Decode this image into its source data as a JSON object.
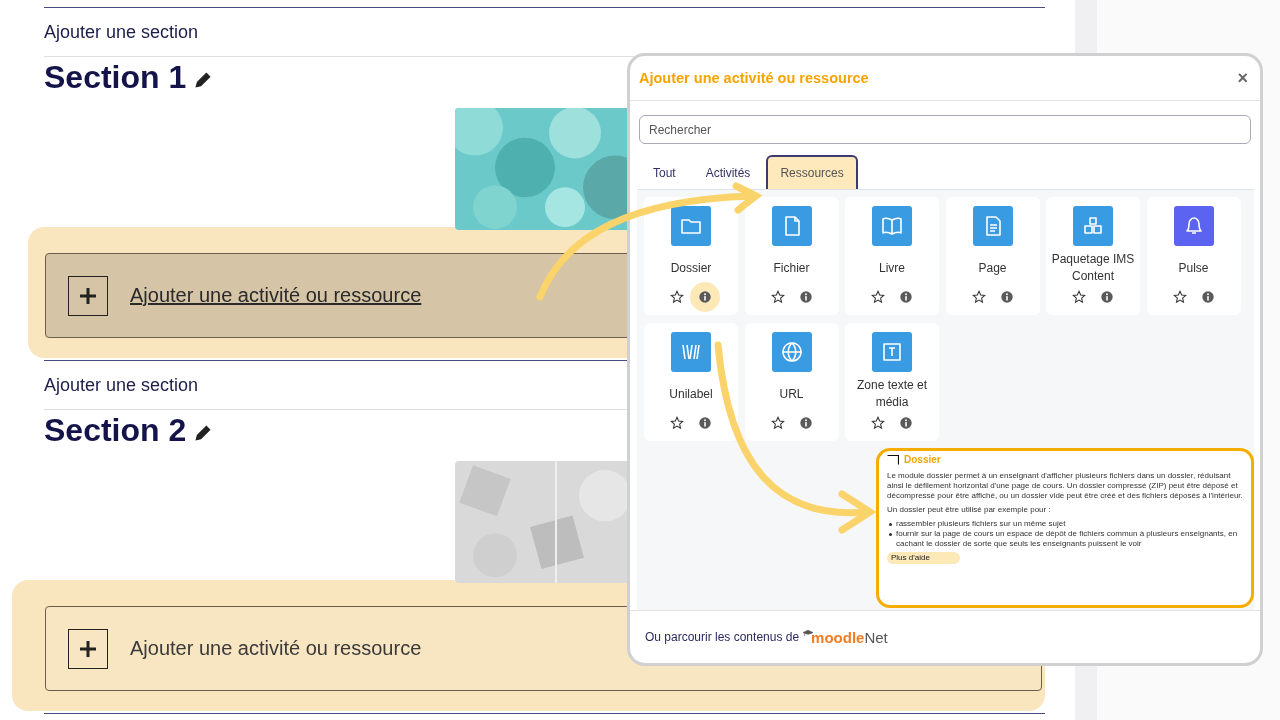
{
  "sections": [
    {
      "add_section": "Ajouter une section",
      "title": "Section 1",
      "add_activity": {
        "label": "Ajouter une activité ou ressource",
        "hovered": true
      }
    },
    {
      "add_section": "Ajouter une section",
      "title": "Section 2",
      "add_activity": {
        "label": "Ajouter une activité ou ressource",
        "hovered": false
      }
    }
  ],
  "modal": {
    "title": "Ajouter une activité ou ressource",
    "close": "×",
    "search": {
      "placeholder": "Rechercher"
    },
    "tabs": [
      {
        "label": "Tout",
        "selected": false
      },
      {
        "label": "Activités",
        "selected": false
      },
      {
        "label": "Ressources",
        "selected": true
      }
    ],
    "items": [
      {
        "label": "Dossier",
        "color": "#399be2",
        "info_highlighted": true
      },
      {
        "label": "Fichier",
        "color": "#399be2",
        "info_highlighted": false
      },
      {
        "label": "Livre",
        "color": "#399be2",
        "info_highlighted": false
      },
      {
        "label": "Page",
        "color": "#399be2",
        "info_highlighted": false
      },
      {
        "label": "Paquetage IMS Content",
        "color": "#399be2",
        "info_highlighted": false
      },
      {
        "label": "Pulse",
        "color": "#5b63f0",
        "info_highlighted": false
      },
      {
        "label": "Unilabel",
        "color": "#399be2",
        "info_highlighted": false
      },
      {
        "label": "URL",
        "color": "#399be2",
        "info_highlighted": false
      },
      {
        "label": "Zone texte et média",
        "color": "#399be2",
        "info_highlighted": false
      }
    ],
    "help": {
      "title": "Dossier",
      "paragraph": "Le module dossier permet à un enseignant d'afficher plusieurs fichiers dans un dossier, réduisant ainsi le défilement horizontal d'une page de cours. Un dossier compressé (ZIP) peut être déposé et décompressé pour être affiché, ou un dossier vide peut être créé et des fichiers déposés à l'intérieur.",
      "intro": "Un dossier peut être utilisé par exemple pour :",
      "bullets": [
        "rassembler plusieurs fichiers sur un même sujet",
        "fournir sur la page de cours un espace de dépôt de fichiers commun à plusieurs enseignants, en cachant le dossier de sorte que seuls les enseignants puissent le voir"
      ],
      "more": {
        "label": "Plus d'aide",
        "highlighted": true
      }
    },
    "footer": {
      "text": "Ou parcourir les contenus de",
      "logo_a": "moodle",
      "logo_b": "Net"
    }
  }
}
